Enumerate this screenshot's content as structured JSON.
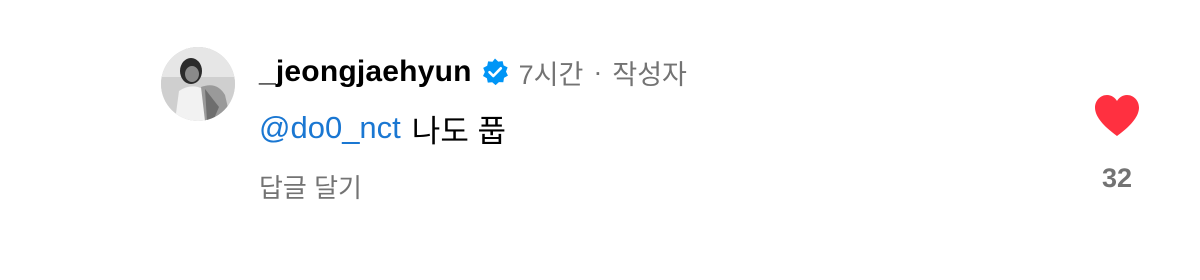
{
  "comment": {
    "username": "_jeongjaehyun",
    "verified_icon": "verified-badge-icon",
    "time": "7시간",
    "separator": "·",
    "author_tag": "작성자",
    "mention": "@do0_nct",
    "text": "나도 풉",
    "reply_label": "답글 달기",
    "like_icon": "heart-icon",
    "like_count": "32",
    "liked": true
  },
  "colors": {
    "mention": "#1a77d2",
    "verified": "#0095f6",
    "heart": "#ff3040",
    "muted": "#737373"
  }
}
